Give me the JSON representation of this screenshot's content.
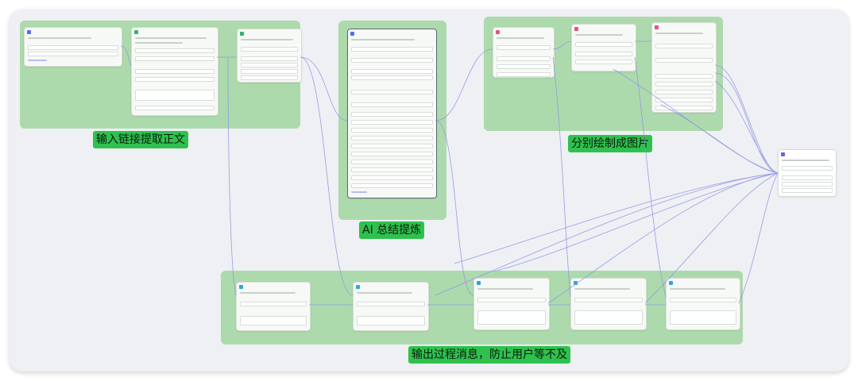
{
  "groups": [
    {
      "id": "g1",
      "label": "输入链接提取正文"
    },
    {
      "id": "g2",
      "label": "AI 总结提炼"
    },
    {
      "id": "g3",
      "label": "分别绘制成图片"
    },
    {
      "id": "g4",
      "label": "输出过程消息，防止用户等不及"
    }
  ],
  "colors": {
    "group_fill": "#a9d8a8",
    "label_fill": "#2fc14e",
    "wire": "#8f93e8",
    "canvas": "#eef0f3"
  },
  "icons": [
    "node-icon",
    "wire-connector"
  ]
}
